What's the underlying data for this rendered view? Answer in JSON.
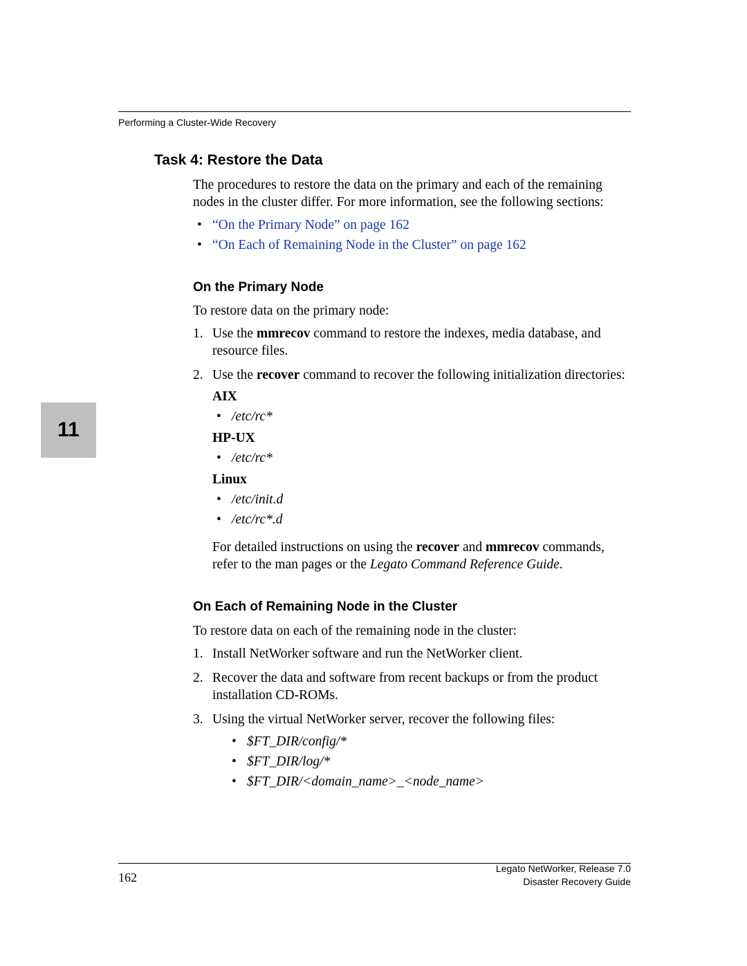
{
  "header": {
    "text": "Performing a Cluster-Wide Recovery"
  },
  "chapter": {
    "number": "11"
  },
  "footer": {
    "page": "162",
    "line1": "Legato NetWorker, Release 7.0",
    "line2": "Disaster Recovery Guide"
  },
  "body": {
    "task4_title": "Task 4: Restore the Data",
    "task4_para": "The procedures to restore the data on the primary and each of the remaining nodes in the cluster differ. For more information, see the following sections:",
    "task4_links": {
      "link1": "“On the Primary Node” on page 162",
      "link2": "“On Each of Remaining Node in the Cluster” on page 162"
    },
    "primary_title": "On the Primary Node",
    "primary_intro": "To restore data on the primary node:",
    "primary_step1_a": "Use the ",
    "primary_step1_b": "mmrecov",
    "primary_step1_c": " command to restore the indexes, media database, and resource files.",
    "primary_step2_a": "Use the ",
    "primary_step2_b": "recover",
    "primary_step2_c": " command to recover the following initialization directories:",
    "os": {
      "aix_label": "AIX",
      "aix_item": "/etc/rc*",
      "hpux_label": "HP-UX",
      "hpux_item": "/etc/rc*",
      "linux_label": "Linux",
      "linux_item1": "/etc/init.d",
      "linux_item2": "/etc/rc*.d"
    },
    "primary_closing_a": "For detailed instructions on using the ",
    "primary_closing_b": "recover",
    "primary_closing_c": " and ",
    "primary_closing_d": "mmrecov",
    "primary_closing_e": " commands, refer to the man pages or the ",
    "primary_closing_f": "Legato Command Reference Guide",
    "primary_closing_g": ".",
    "remaining_title": "On Each of Remaining Node in the Cluster",
    "remaining_intro": "To restore data on each of the remaining node in the cluster:",
    "remaining_step1": "Install NetWorker software and run the NetWorker client.",
    "remaining_step2": "Recover the data and software from recent backups or from the product installation CD-ROMs.",
    "remaining_step3": "Using the virtual NetWorker server, recover the following files:",
    "remaining_files": {
      "f1": "$FT_DIR/config/*",
      "f2": "$FT_DIR/log/*",
      "f3": "$FT_DIR/<domain_name>_<node_name>"
    }
  }
}
